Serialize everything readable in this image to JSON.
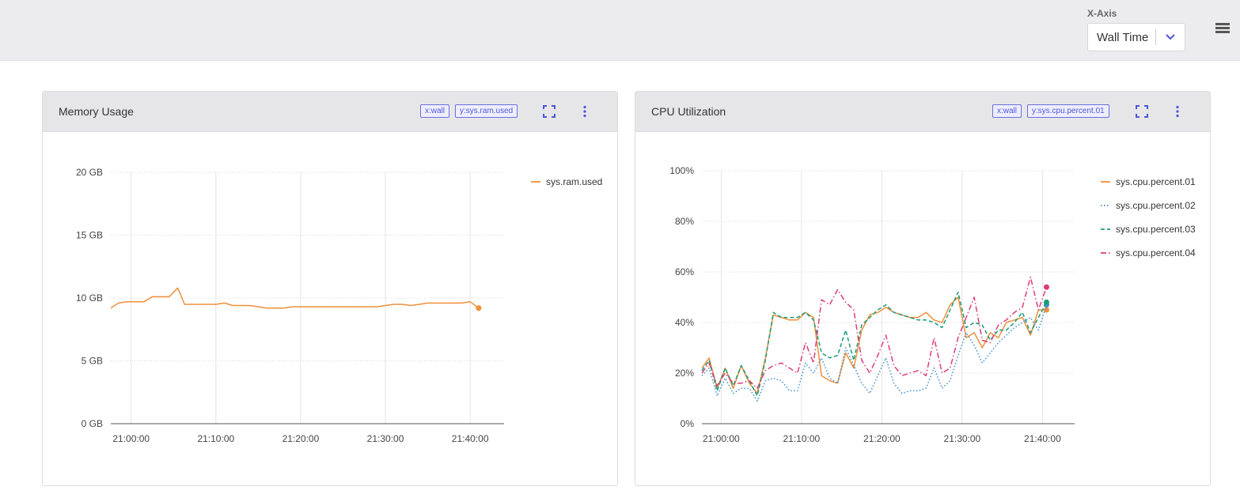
{
  "header": {
    "xaxis_label": "X-Axis",
    "xaxis_value": "Wall Time"
  },
  "panels": [
    {
      "title": "Memory Usage",
      "tags": [
        "x:wall",
        "y:sys.ram.used"
      ]
    },
    {
      "title": "CPU Utilization",
      "tags": [
        "x:wall",
        "y:sys.cpu.percent.01"
      ]
    }
  ],
  "chart_data": [
    {
      "type": "line",
      "title": "Memory Usage",
      "x_ticks": [
        "21:00:00",
        "21:10:00",
        "21:20:00",
        "21:30:00",
        "21:40:00"
      ],
      "y_ticks": [
        "0 GB",
        "5 GB",
        "10 GB",
        "15 GB",
        "20 GB"
      ],
      "ylim": [
        0,
        20
      ],
      "xlim_minutes": [
        -2.4,
        44
      ],
      "grid": true,
      "legend_position": "top-right",
      "colors": [
        "#f0903a"
      ],
      "series": [
        {
          "name": "sys.ram.used",
          "x": [
            -2.4,
            -1.5,
            -0.5,
            0.8,
            1.5,
            2.5,
            3.5,
            4.5,
            5.5,
            6.3,
            7.0,
            8.0,
            9.0,
            10.0,
            11.0,
            12.0,
            13.0,
            14.0,
            15.0,
            16.0,
            17.0,
            18.0,
            19.0,
            20.0,
            21.0,
            22.0,
            23.0,
            24.0,
            25.0,
            26.0,
            27.0,
            28.0,
            29.0,
            30.0,
            31.0,
            32.0,
            33.0,
            34.0,
            35.0,
            36.0,
            37.0,
            38.0,
            39.0,
            40.0,
            41.0
          ],
          "y": [
            9.2,
            9.6,
            9.7,
            9.7,
            9.7,
            10.1,
            10.1,
            10.1,
            10.8,
            9.5,
            9.5,
            9.5,
            9.5,
            9.5,
            9.6,
            9.4,
            9.4,
            9.4,
            9.3,
            9.2,
            9.2,
            9.2,
            9.3,
            9.3,
            9.3,
            9.3,
            9.3,
            9.3,
            9.3,
            9.3,
            9.3,
            9.3,
            9.3,
            9.4,
            9.5,
            9.5,
            9.4,
            9.5,
            9.6,
            9.6,
            9.6,
            9.6,
            9.6,
            9.7,
            9.2
          ]
        }
      ]
    },
    {
      "type": "line",
      "title": "CPU Utilization",
      "x_ticks": [
        "21:00:00",
        "21:10:00",
        "21:20:00",
        "21:30:00",
        "21:40:00"
      ],
      "y_ticks": [
        "0%",
        "20%",
        "40%",
        "60%",
        "80%",
        "100%"
      ],
      "ylim": [
        0,
        100
      ],
      "xlim_minutes": [
        -2.4,
        44
      ],
      "grid": true,
      "legend_position": "top-right",
      "colors": [
        "#f0903a",
        "#3f8fd4",
        "#1a9c7a",
        "#dc3d7a"
      ],
      "x": [
        -2.4,
        -1.5,
        -0.5,
        0.5,
        1.5,
        2.5,
        3.5,
        4.5,
        5.5,
        6.5,
        7.5,
        8.5,
        9.5,
        10.5,
        11.5,
        12.5,
        13.5,
        14.5,
        15.5,
        16.5,
        17.5,
        18.5,
        19.5,
        20.5,
        21.5,
        22.5,
        23.5,
        24.5,
        25.5,
        26.5,
        27.5,
        28.5,
        29.5,
        30.5,
        31.5,
        32.5,
        33.5,
        34.5,
        35.5,
        36.5,
        37.5,
        38.5,
        39.5,
        40.5
      ],
      "series": [
        {
          "name": "sys.cpu.percent.01",
          "style": "solid",
          "y": [
            22,
            26,
            14,
            22,
            14,
            23,
            16,
            12,
            26,
            43,
            42,
            41,
            41,
            44,
            42,
            19,
            17,
            16,
            28,
            22,
            37,
            43,
            44,
            46,
            44,
            43,
            42,
            42,
            44,
            41,
            40,
            47,
            50,
            34,
            36,
            30,
            36,
            34,
            40,
            41,
            42,
            35,
            45,
            45
          ]
        },
        {
          "name": "sys.cpu.percent.02",
          "style": "dotted",
          "y": [
            19,
            22,
            11,
            18,
            12,
            14,
            14,
            9,
            17,
            18,
            17,
            13,
            13,
            24,
            20,
            26,
            18,
            16,
            30,
            23,
            16,
            12,
            19,
            26,
            16,
            12,
            13,
            13,
            14,
            22,
            14,
            17,
            27,
            36,
            31,
            24,
            28,
            32,
            35,
            38,
            40,
            42,
            37,
            47
          ]
        },
        {
          "name": "sys.cpu.percent.03",
          "style": "dashed",
          "y": [
            21,
            25,
            13,
            22,
            15,
            23,
            17,
            11,
            25,
            44,
            42,
            42,
            42,
            44,
            41,
            28,
            26,
            27,
            37,
            25,
            39,
            42,
            45,
            47,
            44,
            43,
            42,
            41,
            41,
            40,
            38,
            45,
            52,
            38,
            40,
            39,
            33,
            37,
            37,
            40,
            44,
            36,
            42,
            48
          ]
        },
        {
          "name": "sys.cpu.percent.04",
          "style": "dashdot",
          "y": [
            20,
            24,
            15,
            20,
            16,
            16,
            17,
            14,
            21,
            23,
            24,
            22,
            20,
            32,
            24,
            49,
            47,
            53,
            48,
            45,
            25,
            20,
            27,
            35,
            23,
            19,
            20,
            21,
            19,
            34,
            20,
            22,
            34,
            42,
            50,
            33,
            32,
            39,
            41,
            44,
            46,
            58,
            45,
            54
          ]
        }
      ]
    }
  ]
}
